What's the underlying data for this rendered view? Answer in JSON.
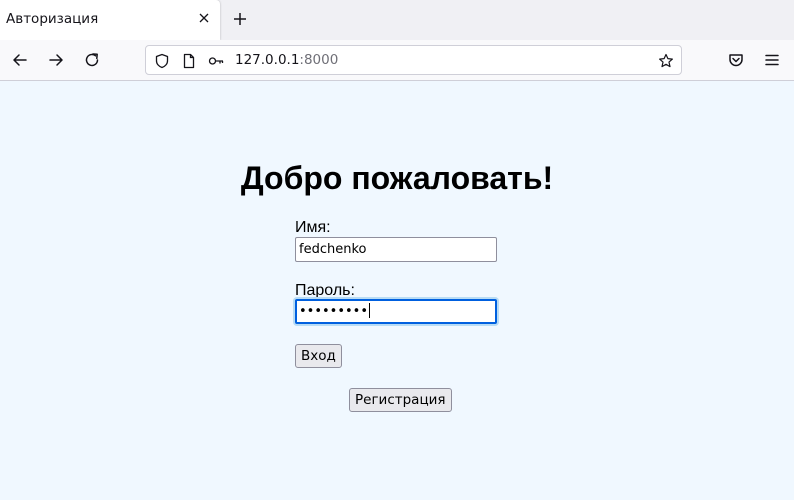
{
  "browser": {
    "tab_title": "Авторизация",
    "url_host": "127.0.0.1",
    "url_port": ":8000",
    "icons": [
      "close-icon",
      "plus-icon",
      "back-icon",
      "forward-icon",
      "reload-icon",
      "shield-icon",
      "page-icon",
      "key-icon",
      "star-icon",
      "pocket-icon",
      "menu-icon"
    ]
  },
  "page": {
    "heading": "Добро пожаловать!",
    "name_label": "Имя:",
    "name_value": "fedchenko",
    "password_label": "Пароль:",
    "password_mask": "•••••••••",
    "login_button": "Вход",
    "register_button": "Регистрация"
  },
  "colors": {
    "page_background": "#f0f8ff",
    "focus_ring": "#0060df"
  }
}
